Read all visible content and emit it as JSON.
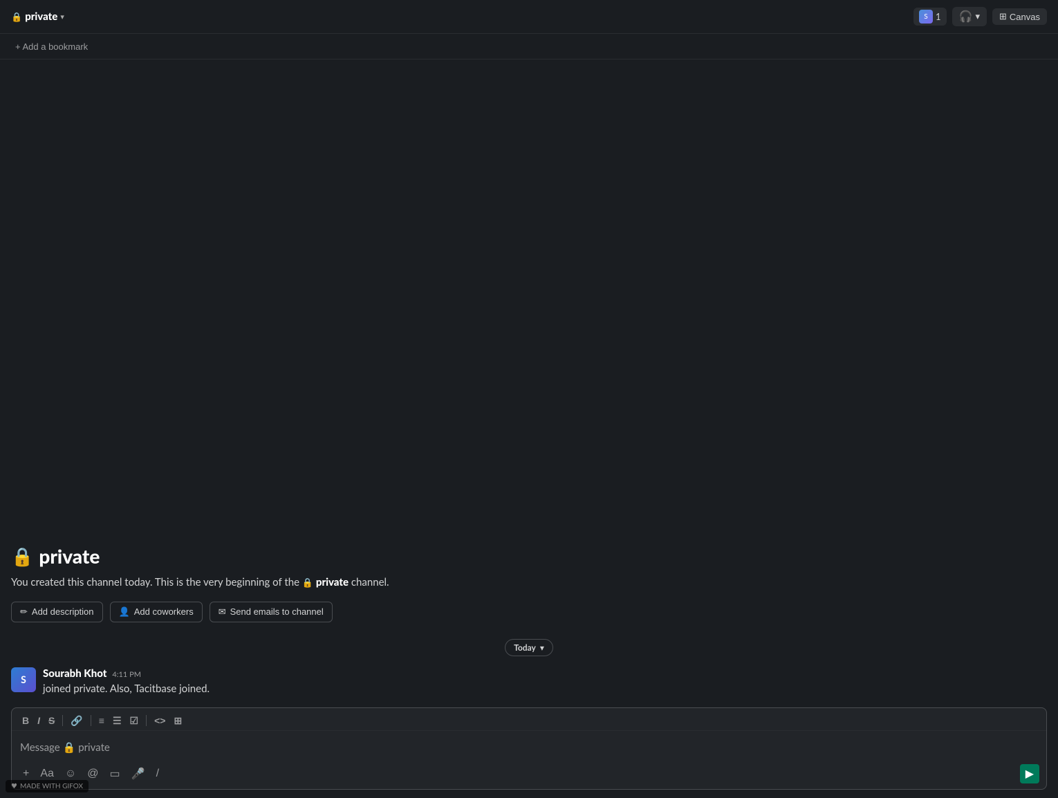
{
  "header": {
    "channel_name": "private",
    "chevron": "▾",
    "member_count": "1",
    "headphone_label": "",
    "canvas_label": "Canvas"
  },
  "bookmark_bar": {
    "add_bookmark_label": "+ Add a bookmark"
  },
  "welcome": {
    "channel_title": "private",
    "description_prefix": "You created this channel today. This is the very beginning of the",
    "channel_ref": "private",
    "description_suffix": "channel.",
    "buttons": [
      {
        "id": "add-description",
        "icon": "✏",
        "label": "Add description"
      },
      {
        "id": "add-coworkers",
        "icon": "👤",
        "label": "Add coworkers"
      },
      {
        "id": "send-emails",
        "icon": "✉",
        "label": "Send emails to channel"
      }
    ]
  },
  "date_divider": {
    "label": "Today",
    "chevron": "▾"
  },
  "message": {
    "author": "Sourabh Khot",
    "time": "4:11 PM",
    "text": "joined private. Also, Tacitbase joined."
  },
  "input": {
    "placeholder": "Message",
    "channel_ref": "🔒 private",
    "toolbar_buttons": [
      {
        "id": "bold",
        "label": "B"
      },
      {
        "id": "italic",
        "label": "I"
      },
      {
        "id": "strike",
        "label": "S"
      },
      {
        "id": "link",
        "label": "🔗"
      },
      {
        "id": "ordered-list",
        "label": "≡"
      },
      {
        "id": "unordered-list",
        "label": "☰"
      },
      {
        "id": "checklist",
        "label": "☑"
      },
      {
        "id": "code",
        "label": "<>"
      },
      {
        "id": "code-block",
        "label": "⊞"
      }
    ],
    "bottom_buttons": [
      {
        "id": "attach",
        "icon": "+"
      },
      {
        "id": "format",
        "icon": "Aa"
      },
      {
        "id": "emoji",
        "icon": "☺"
      },
      {
        "id": "mention",
        "icon": "@"
      },
      {
        "id": "media",
        "icon": "▭"
      },
      {
        "id": "audio",
        "icon": "🎤"
      },
      {
        "id": "slash",
        "icon": "/"
      }
    ],
    "send_icon": "▶"
  },
  "gifox": {
    "label": "MADE WITH GIFOX",
    "icon": "♥"
  }
}
